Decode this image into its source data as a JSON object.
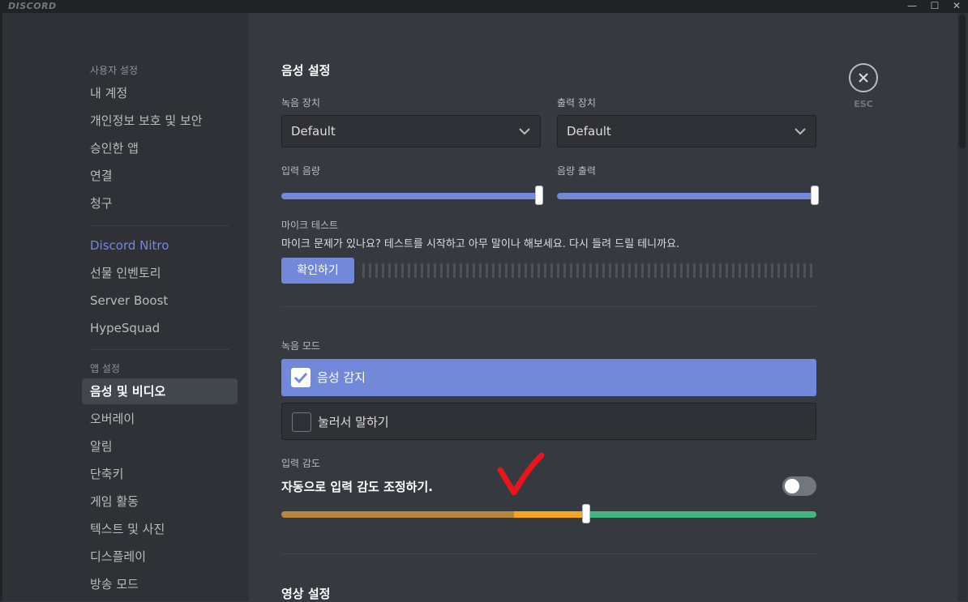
{
  "titlebar": {
    "logo": "DISCORD",
    "minimize": "—",
    "maximize": "☐",
    "close": "✕"
  },
  "sidebar": {
    "user_settings_header": "사용자 설정",
    "user_items": [
      "내 계정",
      "개인정보 보호 및 보안",
      "승인한 앱",
      "연결",
      "청구"
    ],
    "nitro_items": [
      "Discord Nitro",
      "선물 인벤토리",
      "Server Boost",
      "HypeSquad"
    ],
    "app_settings_header": "앱 설정",
    "app_items": [
      "음성 및 비디오",
      "오버레이",
      "알림",
      "단축키",
      "게임 활동",
      "텍스트 및 사진",
      "디스플레이",
      "방송 모드"
    ],
    "selected": "음성 및 비디오"
  },
  "voice": {
    "title": "음성 설정",
    "input_device_label": "녹음 장치",
    "input_device_value": "Default",
    "output_device_label": "출력 장치",
    "output_device_value": "Default",
    "input_volume_label": "입력 음량",
    "input_volume": 1.0,
    "output_volume_label": "음량 출력",
    "output_volume": 1.0,
    "mic_test_label": "마이크 테스트",
    "mic_test_desc": "마이크 문제가 있나요? 테스트를 시작하고 아무 말이나 해보세요. 다시 들려 드릴 테니까요.",
    "mic_test_button": "확인하기",
    "input_mode_label": "녹음 모드",
    "mode_voice_activity": "음성 감지",
    "mode_push_to_talk": "눌러서 말하기",
    "sensitivity_label": "입력 감도",
    "auto_sensitivity_label": "자동으로 입력 감도 조정하기.",
    "auto_sensitivity_enabled": false,
    "sensitivity_level": 0.57,
    "video_title": "영상 설정"
  },
  "close": {
    "label": "ESC"
  },
  "colors": {
    "accent": "#7289da",
    "annotation": "#e8141e",
    "sens_dark": "#b7873e",
    "sens_light": "#faa61a",
    "sens_green": "#43b581"
  }
}
